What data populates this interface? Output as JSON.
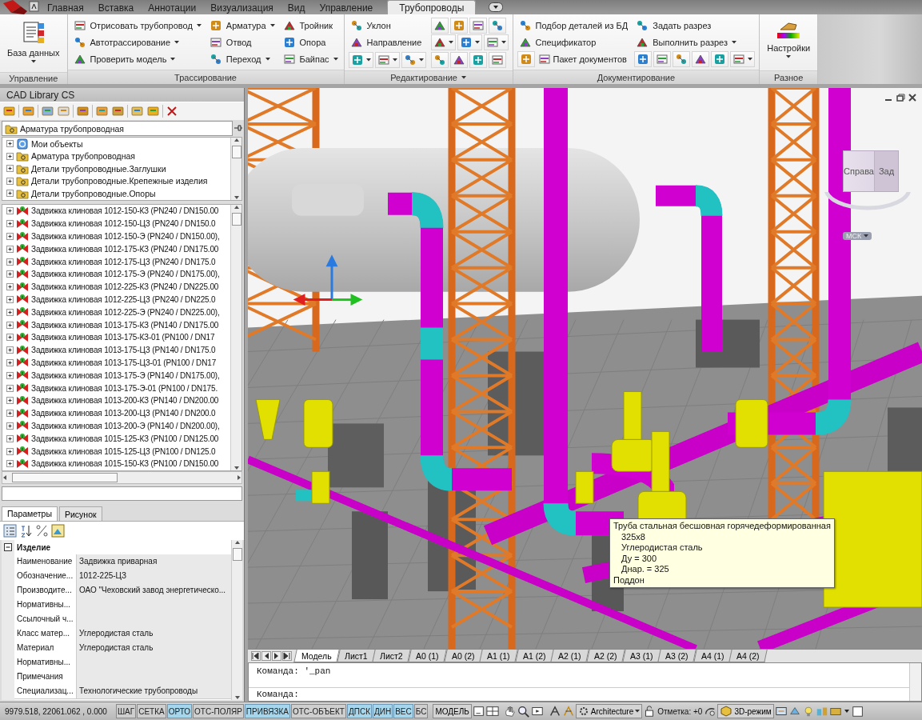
{
  "ribbon": {
    "tabs": [
      {
        "label": "Главная",
        "selected": false
      },
      {
        "label": "Вставка",
        "selected": false
      },
      {
        "label": "Аннотации",
        "selected": false
      },
      {
        "label": "Визуализация",
        "selected": false
      },
      {
        "label": "Вид",
        "selected": false
      },
      {
        "label": "Управление",
        "selected": false
      },
      {
        "label": "Трубопроводы",
        "selected": true
      }
    ],
    "panels": [
      {
        "title": "Управление",
        "dropdown": false,
        "columns": [
          [
            {
              "kind": "large",
              "label": "База данных",
              "dropdown": true
            }
          ]
        ]
      },
      {
        "title": "Трассирование",
        "dropdown": false,
        "columns": [
          [
            {
              "kind": "small",
              "label": "Отрисовать трубопровод",
              "dropdown": true
            },
            {
              "kind": "small",
              "label": "Автотрассирование",
              "dropdown": true
            },
            {
              "kind": "small",
              "label": "Проверить модель",
              "dropdown": true
            }
          ],
          [
            {
              "kind": "small",
              "label": "Арматура",
              "dropdown": true
            },
            {
              "kind": "small",
              "label": "Отвод",
              "dropdown": false
            },
            {
              "kind": "small",
              "label": "Переход",
              "dropdown": true
            }
          ],
          [
            {
              "kind": "small",
              "label": "Тройник",
              "dropdown": false
            },
            {
              "kind": "small",
              "label": "Опора",
              "dropdown": false
            },
            {
              "kind": "small",
              "label": "Байпас",
              "dropdown": true
            }
          ]
        ]
      },
      {
        "title": "Редактирование",
        "dropdown": true,
        "columns": [
          [
            {
              "kind": "small",
              "label": "Уклон",
              "dropdown": false
            },
            {
              "kind": "small",
              "label": "Направление",
              "dropdown": false
            },
            {
              "kind": "icon-row",
              "buttons": [
                {
                  "dropdown": true
                },
                {
                  "dropdown": true
                },
                {
                  "dropdown": true
                }
              ]
            }
          ],
          [
            {
              "kind": "icon-row",
              "buttons": [
                {
                  "dropdown": false
                },
                {
                  "dropdown": false
                },
                {
                  "dropdown": false
                },
                {
                  "dropdown": false
                }
              ]
            },
            {
              "kind": "icon-row",
              "buttons": [
                {
                  "dropdown": true
                },
                {
                  "dropdown": true
                },
                {
                  "dropdown": true
                }
              ]
            },
            {
              "kind": "icon-row",
              "buttons": [
                {
                  "dropdown": false
                },
                {
                  "dropdown": false
                },
                {
                  "dropdown": false
                },
                {
                  "dropdown": false
                }
              ]
            }
          ]
        ]
      },
      {
        "title": "Документирование",
        "dropdown": false,
        "columns": [
          [
            {
              "kind": "small",
              "label": "Подбор деталей из БД",
              "dropdown": false
            },
            {
              "kind": "small",
              "label": "Спецификатор",
              "dropdown": false
            },
            {
              "kind": "icon-row",
              "buttons": [
                {
                  "dropdown": false
                },
                {
                  "dropdown": false,
                  "label": "Пакет документов"
                }
              ]
            }
          ],
          [
            {
              "kind": "small",
              "label": "Задать разрез",
              "dropdown": false
            },
            {
              "kind": "small",
              "label": "Выполнить разрез",
              "dropdown": true
            },
            {
              "kind": "icon-row",
              "buttons": [
                {
                  "dropdown": false
                },
                {
                  "dropdown": false
                },
                {
                  "dropdown": false
                },
                {
                  "dropdown": false
                },
                {
                  "dropdown": false
                },
                {
                  "dropdown": true
                }
              ]
            }
          ]
        ]
      },
      {
        "title": "Разное",
        "dropdown": false,
        "columns": [
          [
            {
              "kind": "large",
              "label": "Настройки",
              "dropdown": true
            }
          ]
        ]
      }
    ]
  },
  "library": {
    "title": "CAD Library CS",
    "category": "Арматура трубопроводная",
    "tree": [
      {
        "label": "Мои объекты",
        "kind": "user"
      },
      {
        "label": "Арматура трубопроводная",
        "kind": "folder"
      },
      {
        "label": "Детали трубопроводные.Заглушки",
        "kind": "folder"
      },
      {
        "label": "Детали трубопроводные.Крепежные изделия",
        "kind": "folder"
      },
      {
        "label": "Детали трубопроводные.Опоры",
        "kind": "folder"
      }
    ],
    "items": [
      "Задвижка клиновая 1012-150-КЗ (PN240 / DN150.00",
      "Задвижка клиновая 1012-150-ЦЗ (PN240 / DN150.0",
      "Задвижка клиновая 1012-150-Э (PN240 / DN150.00),",
      "Задвижка клиновая 1012-175-КЗ (PN240 / DN175.00",
      "Задвижка клиновая 1012-175-ЦЗ (PN240 / DN175.0",
      "Задвижка клиновая 1012-175-Э (PN240 / DN175.00),",
      "Задвижка клиновая 1012-225-КЗ (PN240 / DN225.00",
      "Задвижка клиновая 1012-225-ЦЗ (PN240 / DN225.0",
      "Задвижка клиновая 1012-225-Э (PN240 / DN225.00),",
      "Задвижка клиновая 1013-175-КЗ (PN140 / DN175.00",
      "Задвижка клиновая 1013-175-КЗ-01 (PN100 / DN17",
      "Задвижка клиновая 1013-175-ЦЗ (PN140 / DN175.0",
      "Задвижка клиновая 1013-175-ЦЗ-01 (PN100 / DN17",
      "Задвижка клиновая 1013-175-Э (PN140 / DN175.00),",
      "Задвижка клиновая 1013-175-Э-01 (PN100 / DN175.",
      "Задвижка клиновая 1013-200-КЗ (PN140 / DN200.00",
      "Задвижка клиновая 1013-200-ЦЗ (PN140 / DN200.0",
      "Задвижка клиновая 1013-200-Э (PN140 / DN200.00),",
      "Задвижка клиновая 1015-125-КЗ (PN100 / DN125.00",
      "Задвижка клиновая 1015-125-ЦЗ (PN100 / DN125.0",
      "Задвижка клиновая 1015-150-КЗ (PN100 / DN150.00"
    ]
  },
  "properties": {
    "tabs": [
      {
        "label": "Параметры",
        "selected": true
      },
      {
        "label": "Рисунок",
        "selected": false
      }
    ],
    "group": {
      "label": "Изделие",
      "expanded": true
    },
    "rows": [
      {
        "name": "Наименование",
        "value": "Задвижка приварная"
      },
      {
        "name": "Обозначение...",
        "value": "1012-225-ЦЗ"
      },
      {
        "name": "Производите...",
        "value": "ОАО \"Чеховский завод энергетическо..."
      },
      {
        "name": "Нормативны..."
      },
      {
        "name": "Ссылочный ч..."
      },
      {
        "name": "Класс матер...",
        "value": "Углеродистая сталь"
      },
      {
        "name": "Материал",
        "value": "Углеродистая сталь"
      },
      {
        "name": "Нормативны..."
      },
      {
        "name": "Примечания"
      },
      {
        "name": "Специализац...",
        "value": "Технологические трубопроводы"
      }
    ]
  },
  "viewport": {
    "viewcube": {
      "faces": [
        "Справа",
        "Зад"
      ],
      "ucs": "МСК"
    },
    "tooltip": [
      {
        "text": "Труба стальная бесшовная горячедеформированная",
        "indented": false
      },
      {
        "text": "325x8",
        "indented": true
      },
      {
        "text": "Углеродистая сталь",
        "indented": true
      },
      {
        "text": "Ду = 300",
        "indented": true
      },
      {
        "text": "Днар. = 325",
        "indented": true
      },
      {
        "text": "Поддон",
        "indented": false
      }
    ]
  },
  "layout_tabs": [
    {
      "label": "Модель",
      "selected": true
    },
    {
      "label": "Лист1",
      "selected": false
    },
    {
      "label": "Лист2",
      "selected": false
    },
    {
      "label": "A0 (1)",
      "selected": false
    },
    {
      "label": "A0 (2)",
      "selected": false
    },
    {
      "label": "A1 (1)",
      "selected": false
    },
    {
      "label": "A1 (2)",
      "selected": false
    },
    {
      "label": "A2 (1)",
      "selected": false
    },
    {
      "label": "A2 (2)",
      "selected": false
    },
    {
      "label": "A3 (1)",
      "selected": false
    },
    {
      "label": "A3 (2)",
      "selected": false
    },
    {
      "label": "A4 (1)",
      "selected": false
    },
    {
      "label": "A4 (2)",
      "selected": false
    }
  ],
  "command_line": {
    "history": [
      "Команда: '_pan"
    ],
    "prompt": "Команда:"
  },
  "status_bar": {
    "coordinates": "9979.518,  22061.062 , 0.000",
    "toggles": [
      {
        "label": "ШАГ",
        "on": false
      },
      {
        "label": "СЕТКА",
        "on": false
      },
      {
        "label": "ОРТО",
        "on": true
      },
      {
        "label": "ОТС-ПОЛЯР",
        "on": false
      },
      {
        "label": "ПРИВЯЗКА",
        "on": true
      },
      {
        "label": "ОТС-ОБЪЕКТ",
        "on": false
      },
      {
        "label": "ДПСК",
        "on": true
      },
      {
        "label": "ДИН",
        "on": true
      },
      {
        "label": "ВЕС",
        "on": true
      },
      {
        "label": "БС",
        "on": false
      }
    ],
    "space": "МОДЕЛЬ",
    "workspace": "Architecture",
    "elevation": "Отметка:  +0",
    "mode": "3D-режим"
  }
}
